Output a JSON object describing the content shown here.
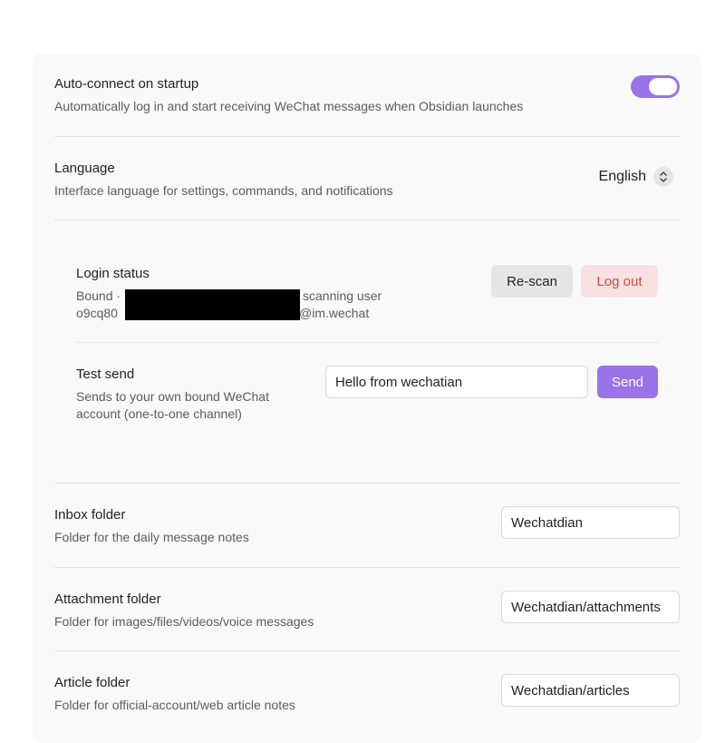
{
  "auto_connect": {
    "title": "Auto-connect on startup",
    "description": "Automatically log in and start receiving WeChat messages when Obsidian launches",
    "enabled": true
  },
  "language": {
    "title": "Language",
    "description": "Interface language for settings, commands, and notifications",
    "selected": "English"
  },
  "login_status": {
    "title": "Login status",
    "line1_prefix": "Bound ·",
    "line1_suffix": "scanning user",
    "line2_prefix": "o9cq80",
    "line2_suffix": "@im.wechat",
    "rescan_label": "Re-scan",
    "logout_label": "Log out"
  },
  "test_send": {
    "title": "Test send",
    "description_line1": "Sends to your own bound WeChat",
    "description_line2": "account (one-to-one channel)",
    "input_value": "Hello from wechatian",
    "send_label": "Send"
  },
  "inbox_folder": {
    "title": "Inbox folder",
    "description": "Folder for the daily message notes",
    "value": "Wechatdian"
  },
  "attachment_folder": {
    "title": "Attachment folder",
    "description": "Folder for images/files/videos/voice messages",
    "value": "Wechatdian/attachments"
  },
  "article_folder": {
    "title": "Article folder",
    "description": "Folder for official-account/web article notes",
    "value": "Wechatdian/articles"
  },
  "colors": {
    "accent": "#9a73e8",
    "danger": "#d64545",
    "panel_bg": "#f9f9f9"
  }
}
